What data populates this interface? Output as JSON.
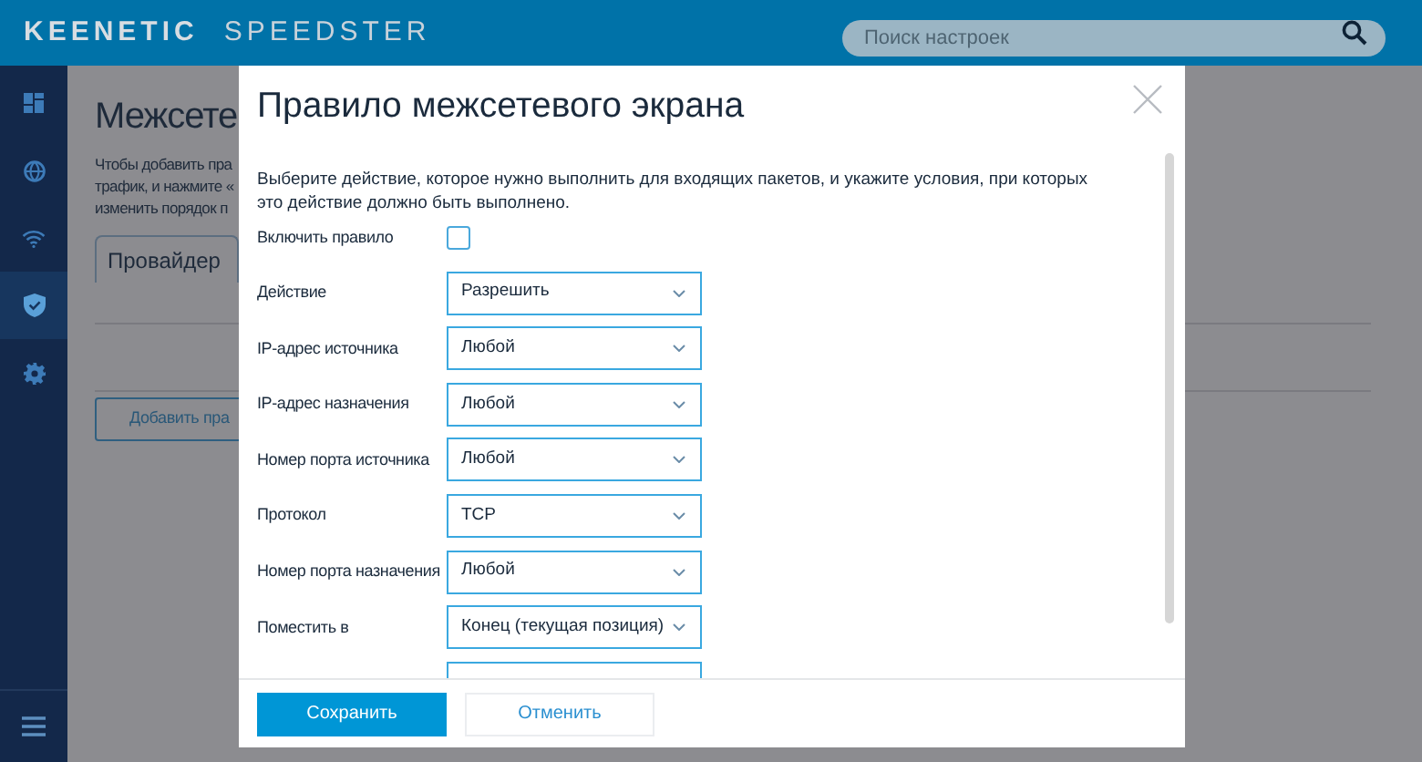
{
  "header": {
    "logo": [
      "KEENETIC",
      "SPEEDSTER"
    ],
    "search": {
      "placeholder": "Поиск настроек"
    }
  },
  "sidebar": {
    "items": [
      {
        "selected": false
      },
      {
        "selected": false
      },
      {
        "selected": false
      },
      {
        "selected": true
      },
      {
        "selected": false
      }
    ]
  },
  "page": {
    "title": "Межсете",
    "description": [
      "Чтобы добавить пра",
      "трафик, и нажмите «",
      "изменить порядок п"
    ],
    "tab": "Провайдер",
    "add_button": "Добавить пра"
  },
  "dialog": {
    "title": "Правило межсетевого экрана",
    "description": "Выберите действие, которое нужно выполнить для входящих пакетов, и укажите условия, при которых это действие должно быть выполнено.",
    "fields": [
      {
        "kind": "checkbox",
        "label": "Включить правило",
        "checked": false
      },
      {
        "kind": "select",
        "label": "Действие",
        "value": "Разрешить"
      },
      {
        "kind": "select",
        "label": "IP-адрес источника",
        "value": "Любой"
      },
      {
        "kind": "select",
        "label": "IP-адрес назначения",
        "value": "Любой"
      },
      {
        "kind": "select",
        "label": "Номер порта источника",
        "value": "Любой"
      },
      {
        "kind": "select",
        "label": "Протокол",
        "value": "TCP"
      },
      {
        "kind": "select",
        "label": "Номер порта назначения",
        "value": "Любой"
      },
      {
        "kind": "select",
        "label": "Поместить в",
        "value": "Конец (текущая позиция)"
      },
      {
        "kind": "select"
      }
    ],
    "buttons": [
      {
        "kind": "primary",
        "label": "Сохранить"
      },
      {
        "kind": "secondary",
        "label": "Отменить"
      }
    ]
  }
}
